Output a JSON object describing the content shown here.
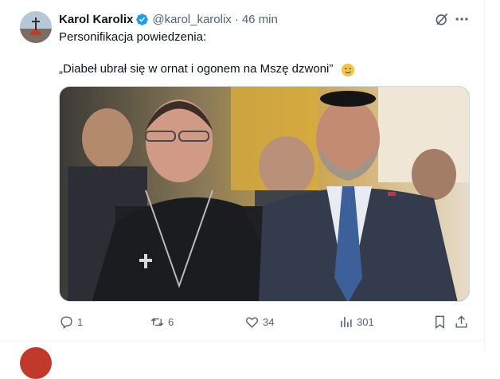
{
  "tweet": {
    "display_name": "Karol Karolix",
    "handle": "@karol_karolix",
    "separator": "·",
    "time": "46 min",
    "line1": "Personifikacja powiedzenia:",
    "line2": "„Diabeł ubrał się w ornat i ogonem na Mszę dzwoni”",
    "emoji_icon": "smiling-face-with-tear-icon"
  },
  "actions": {
    "replies": "1",
    "reposts": "6",
    "likes": "34",
    "views": "301"
  },
  "colors": {
    "text": "#0f1419",
    "muted": "#536471",
    "verified": "#1d9bf0",
    "border": "#eff3f4"
  }
}
